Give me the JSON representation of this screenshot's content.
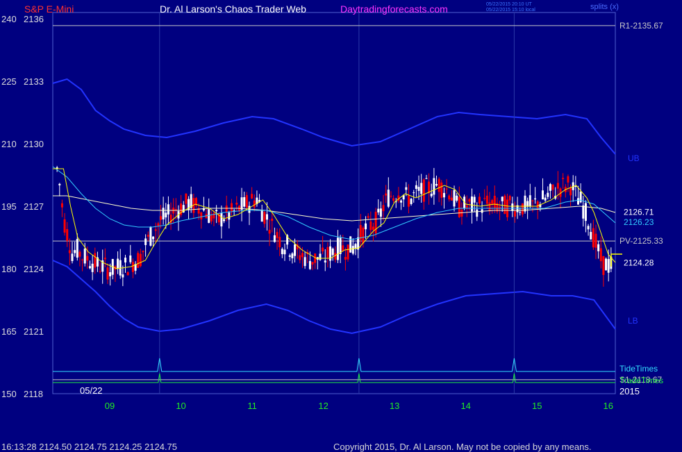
{
  "header": {
    "symbol": "S&P E-Mini",
    "author": "Dr. Al Larson's Chaos Trader Web",
    "site": "Daytradingforecasts.com",
    "ut_stamp": "05/22/2015 20:10 UT",
    "local_stamp": "05/22/2015 15:10 local",
    "mode": "splits (x)"
  },
  "footer": {
    "quote": "16:13:28  2124.50 2124.75 2124.25 2124.75",
    "copyright": "Copyright 2015, Dr. Al Larson. May not be copied by any means."
  },
  "colors": {
    "background": "#000080",
    "up_candle": "#ffffff",
    "down_candle": "#ff0000",
    "band": "#2233ff",
    "yellow_ma": "#ffff00",
    "cyan_ma": "#33ccff",
    "white_ma": "#ffffcc",
    "tide_times": "#33ddff",
    "trade_times": "#22ee44",
    "axis_text": "#dddddd",
    "date_labels": "#22ee22"
  },
  "chart_data": {
    "type": "candlestick",
    "title": "S&P E-Mini",
    "date_label": "05/22",
    "year_label": "2015",
    "x_tick_labels": [
      "09",
      "10",
      "11",
      "12",
      "13",
      "14",
      "15",
      "16"
    ],
    "x_range": [
      8.2,
      16.1
    ],
    "y_range": [
      2118,
      2136.3
    ],
    "y_tick_labels": [
      {
        "left": "240",
        "right": "2136"
      },
      {
        "left": "225",
        "right": "2133"
      },
      {
        "left": "210",
        "right": "2130"
      },
      {
        "left": "195",
        "right": "2127"
      },
      {
        "left": "180",
        "right": "2124"
      },
      {
        "left": "165",
        "right": "2121"
      },
      {
        "left": "150",
        "right": "2118"
      }
    ],
    "ticks_y_values": [
      2136,
      2133,
      2130,
      2127,
      2124,
      2121,
      2118
    ],
    "levels": [
      {
        "name": "R1",
        "label": "R1-2135.67",
        "value": 2135.67,
        "color": "#c8c8c8"
      },
      {
        "name": "PV",
        "label": "PV-2125.33",
        "value": 2125.33,
        "color": "#c8c8c8"
      },
      {
        "name": "S1",
        "label": "S1-2118.67",
        "value": 2118.67,
        "color": "#c8c8c8"
      }
    ],
    "price_labels": [
      {
        "label": "2126.71",
        "value": 2126.71,
        "color": "#ffffff"
      },
      {
        "label": "2126.23",
        "value": 2126.23,
        "color": "#33ccff"
      },
      {
        "label": "2124.28",
        "value": 2124.28,
        "color": "#ffffff"
      }
    ],
    "band_labels": [
      {
        "label": "UB",
        "value": 2129.3
      },
      {
        "label": "LB",
        "value": 2121.5
      }
    ],
    "tide_times_label": "TideTimes",
    "trade_times_label": "TradeTimes",
    "event_times": [
      9.7,
      12.5,
      14.68
    ],
    "upper_band": [
      [
        8.2,
        2132.9
      ],
      [
        8.4,
        2133.1
      ],
      [
        8.6,
        2132.6
      ],
      [
        8.8,
        2131.6
      ],
      [
        9.0,
        2131.1
      ],
      [
        9.2,
        2130.7
      ],
      [
        9.5,
        2130.4
      ],
      [
        9.8,
        2130.3
      ],
      [
        10.2,
        2130.6
      ],
      [
        10.6,
        2131.0
      ],
      [
        11.0,
        2131.3
      ],
      [
        11.3,
        2131.2
      ],
      [
        11.7,
        2130.7
      ],
      [
        12.0,
        2130.3
      ],
      [
        12.4,
        2129.9
      ],
      [
        12.8,
        2130.1
      ],
      [
        13.2,
        2130.7
      ],
      [
        13.6,
        2131.3
      ],
      [
        13.9,
        2131.5
      ],
      [
        14.2,
        2131.4
      ],
      [
        14.6,
        2131.3
      ],
      [
        15.0,
        2131.2
      ],
      [
        15.4,
        2131.4
      ],
      [
        15.7,
        2131.2
      ],
      [
        15.9,
        2130.3
      ],
      [
        16.1,
        2129.5
      ]
    ],
    "lower_band": [
      [
        8.2,
        2124.4
      ],
      [
        8.4,
        2124.1
      ],
      [
        8.6,
        2123.5
      ],
      [
        8.8,
        2122.9
      ],
      [
        9.0,
        2122.2
      ],
      [
        9.2,
        2121.6
      ],
      [
        9.4,
        2121.2
      ],
      [
        9.7,
        2121.0
      ],
      [
        10.0,
        2121.1
      ],
      [
        10.4,
        2121.5
      ],
      [
        10.8,
        2122.0
      ],
      [
        11.2,
        2122.3
      ],
      [
        11.5,
        2122.0
      ],
      [
        11.8,
        2121.5
      ],
      [
        12.1,
        2121.1
      ],
      [
        12.4,
        2120.9
      ],
      [
        12.8,
        2121.2
      ],
      [
        13.2,
        2121.8
      ],
      [
        13.6,
        2122.3
      ],
      [
        14.0,
        2122.7
      ],
      [
        14.4,
        2122.8
      ],
      [
        14.8,
        2122.9
      ],
      [
        15.2,
        2122.7
      ],
      [
        15.5,
        2122.7
      ],
      [
        15.8,
        2122.5
      ],
      [
        16.1,
        2121.1
      ]
    ],
    "yellow_ma": [
      [
        8.2,
        2128.8
      ],
      [
        8.35,
        2128.8
      ],
      [
        8.45,
        2127.0
      ],
      [
        8.55,
        2125.5
      ],
      [
        8.7,
        2124.8
      ],
      [
        8.9,
        2124.3
      ],
      [
        9.1,
        2124.0
      ],
      [
        9.3,
        2124.1
      ],
      [
        9.5,
        2124.4
      ],
      [
        9.6,
        2125.0
      ],
      [
        9.8,
        2126.1
      ],
      [
        10.0,
        2126.7
      ],
      [
        10.2,
        2127.1
      ],
      [
        10.4,
        2126.9
      ],
      [
        10.6,
        2126.4
      ],
      [
        10.8,
        2126.6
      ],
      [
        11.0,
        2127.0
      ],
      [
        11.15,
        2127.3
      ],
      [
        11.3,
        2126.6
      ],
      [
        11.5,
        2125.5
      ],
      [
        11.7,
        2124.9
      ],
      [
        11.9,
        2124.5
      ],
      [
        12.1,
        2124.5
      ],
      [
        12.3,
        2124.9
      ],
      [
        12.5,
        2125.0
      ],
      [
        12.7,
        2125.8
      ],
      [
        12.85,
        2126.2
      ],
      [
        13.0,
        2127.2
      ],
      [
        13.15,
        2127.6
      ],
      [
        13.3,
        2127.4
      ],
      [
        13.5,
        2127.7
      ],
      [
        13.7,
        2128.0
      ],
      [
        13.85,
        2127.8
      ],
      [
        14.0,
        2127.1
      ],
      [
        14.2,
        2127.0
      ],
      [
        14.4,
        2127.1
      ],
      [
        14.6,
        2127.0
      ],
      [
        14.8,
        2127.0
      ],
      [
        15.0,
        2127.0
      ],
      [
        15.2,
        2127.3
      ],
      [
        15.4,
        2127.8
      ],
      [
        15.55,
        2128.0
      ],
      [
        15.7,
        2127.4
      ],
      [
        15.8,
        2126.7
      ],
      [
        15.9,
        2125.7
      ],
      [
        16.0,
        2124.7
      ],
      [
        16.1,
        2124.3
      ]
    ],
    "cyan_ma": [
      [
        8.2,
        2128.9
      ],
      [
        8.4,
        2128.4
      ],
      [
        8.6,
        2127.6
      ],
      [
        8.8,
        2126.9
      ],
      [
        9.0,
        2126.4
      ],
      [
        9.2,
        2126.1
      ],
      [
        9.4,
        2126.0
      ],
      [
        9.6,
        2126.0
      ],
      [
        9.8,
        2126.1
      ],
      [
        10.0,
        2126.3
      ],
      [
        10.3,
        2126.5
      ],
      [
        10.6,
        2126.7
      ],
      [
        10.9,
        2126.8
      ],
      [
        11.2,
        2126.8
      ],
      [
        11.5,
        2126.5
      ],
      [
        11.8,
        2126.0
      ],
      [
        12.1,
        2125.6
      ],
      [
        12.4,
        2125.4
      ],
      [
        12.7,
        2125.6
      ],
      [
        13.0,
        2126.0
      ],
      [
        13.3,
        2126.4
      ],
      [
        13.6,
        2126.7
      ],
      [
        13.9,
        2126.9
      ],
      [
        14.2,
        2126.9
      ],
      [
        14.5,
        2126.9
      ],
      [
        14.8,
        2126.9
      ],
      [
        15.1,
        2126.9
      ],
      [
        15.4,
        2127.2
      ],
      [
        15.6,
        2127.3
      ],
      [
        15.8,
        2127.1
      ],
      [
        16.0,
        2126.5
      ],
      [
        16.1,
        2126.2
      ]
    ],
    "white_ma": [
      [
        8.2,
        2127.5
      ],
      [
        8.4,
        2127.5
      ],
      [
        8.7,
        2127.3
      ],
      [
        9.0,
        2127.1
      ],
      [
        9.3,
        2126.9
      ],
      [
        9.6,
        2126.8
      ],
      [
        10.0,
        2126.8
      ],
      [
        10.4,
        2126.9
      ],
      [
        10.8,
        2126.9
      ],
      [
        11.2,
        2126.8
      ],
      [
        11.6,
        2126.6
      ],
      [
        12.0,
        2126.4
      ],
      [
        12.4,
        2126.3
      ],
      [
        12.8,
        2126.4
      ],
      [
        13.2,
        2126.5
      ],
      [
        13.6,
        2126.6
      ],
      [
        14.0,
        2126.7
      ],
      [
        14.4,
        2126.8
      ],
      [
        14.8,
        2126.8
      ],
      [
        15.2,
        2126.9
      ],
      [
        15.6,
        2127.0
      ],
      [
        15.9,
        2126.9
      ],
      [
        16.1,
        2126.7
      ]
    ]
  }
}
